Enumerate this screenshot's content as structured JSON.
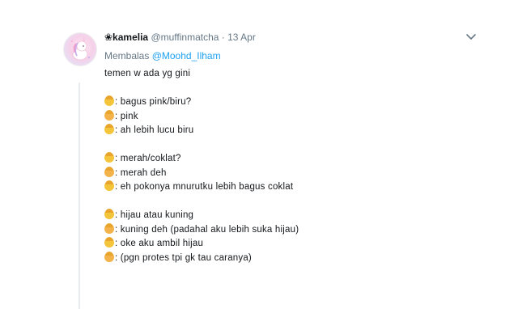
{
  "tweet": {
    "display_name": "❀kamelia",
    "handle": "@muffinmatcha",
    "separator": "·",
    "time": "13 Apr",
    "reply_prefix": "Membalas",
    "reply_to": "@Moohd_Ilham",
    "lines": [
      "temen w ada yg gini",
      "",
      ": bagus pink/biru?",
      ": pink",
      ": ah lebih lucu biru",
      "",
      ": merah/coklat?",
      ": merah deh",
      ": eh pokonya mnurutku lebih bagus coklat",
      "",
      ": hijau atau kuning",
      ": kuning deh (padahal aku lebih suka hijau)",
      ": oke aku ambil hijau",
      ": (pgn protes tpi gk tau caranya)"
    ]
  },
  "icons": {
    "caret": "chevron-down-icon",
    "avatar": "avatar-unicorn-illustration"
  },
  "colors": {
    "link": "#1da1f2",
    "muted": "#657786",
    "text": "#14171a",
    "emoji_a": "#f4c53a",
    "emoji_b": "#f3b24a"
  }
}
